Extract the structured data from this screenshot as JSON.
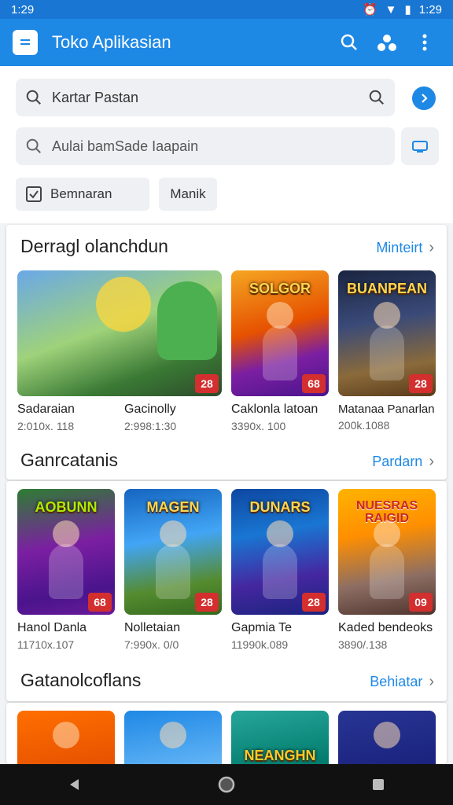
{
  "status_bar": {
    "time": "1:29",
    "right_time": "1:29"
  },
  "app_bar": {
    "title": "Toko Aplikasian"
  },
  "search": {
    "primary_value": "Kartar Pastan",
    "secondary_value": "Aulai bamSade Iaapain"
  },
  "chips": [
    "Bemnaran",
    "Manik"
  ],
  "sections": [
    {
      "title": "Derragl olanchdun",
      "more": "Minteirt",
      "items": [
        {
          "name": "Sadaraian",
          "sub": "2:010x. 118",
          "badge": "28"
        },
        {
          "name": "Gacinolly",
          "sub": "2:998:1:30",
          "badge": ""
        },
        {
          "name": "Caklonla latoan",
          "sub": "3390x. 100",
          "badge": "68",
          "logo": "SOLGOR"
        },
        {
          "name": "Matanaa Panarlan",
          "sub": "200k.1088",
          "badge": "28",
          "logo": "BUANPEAN"
        }
      ]
    },
    {
      "title": "Ganrcatanis",
      "more": "Pardarn",
      "items": [
        {
          "name": "Hanol Danla",
          "sub": "11710x.107",
          "badge": "68",
          "logo": "AOBUNN"
        },
        {
          "name": "Nolletaian",
          "sub": "7:990x. 0/0",
          "badge": "28",
          "logo": "MAGEN"
        },
        {
          "name": "Gapmia Te",
          "sub": "11990k.089",
          "badge": "28",
          "logo": "DUNARS"
        },
        {
          "name": "Kaded bendeoks",
          "sub": "3890/.138",
          "badge": "09",
          "logo": "NUESRAS RAIGID"
        }
      ]
    },
    {
      "title": "Gatanolcoflans",
      "more": "Behiatar",
      "items": [
        {
          "logo": ""
        },
        {
          "logo": ""
        },
        {
          "logo": "NEANGHN"
        },
        {
          "logo": ""
        }
      ]
    }
  ],
  "colors": {
    "accent": "#1e88e5",
    "badge": "#d32f2f"
  }
}
